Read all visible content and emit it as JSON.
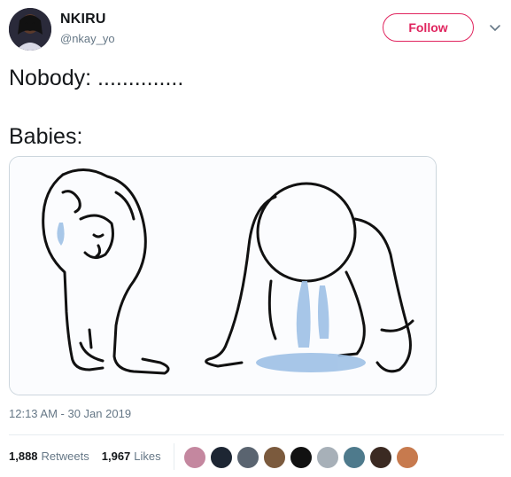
{
  "author": {
    "name": "NKIRU",
    "handle": "@nkay_yo"
  },
  "follow_button": {
    "label": "Follow"
  },
  "tweet": {
    "line1": "Nobody: ..............",
    "line2": "Babies:"
  },
  "timestamp": "12:13 AM - 30 Jan 2019",
  "stats": {
    "retweets_count": "1,888",
    "retweets_label": "Retweets",
    "likes_count": "1,967",
    "likes_label": "Likes"
  },
  "likers": [
    {
      "color": "#c4879f"
    },
    {
      "color": "#1d2633"
    },
    {
      "color": "#5a6470"
    },
    {
      "color": "#7b5a3d"
    },
    {
      "color": "#111111"
    },
    {
      "color": "#a7b0b8"
    },
    {
      "color": "#4e7a8c"
    },
    {
      "color": "#3b2a22"
    },
    {
      "color": "#c77a4e"
    }
  ],
  "colors": {
    "accent": "#e0245e",
    "secondary_text": "#657786",
    "tears": "#9ec1e6"
  }
}
